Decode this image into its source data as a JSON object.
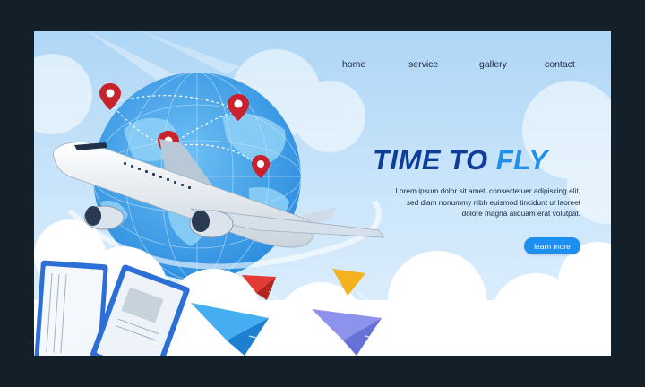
{
  "nav": {
    "items": [
      {
        "label": "home"
      },
      {
        "label": "service"
      },
      {
        "label": "gallery"
      },
      {
        "label": "contact"
      }
    ]
  },
  "hero": {
    "title_part1": "TIME TO ",
    "title_part2": "FLY",
    "description_lines": [
      "Lorem ipsum dolor sit amet, consectetuer adipiscing elit,",
      "sed diam nonummy nibh euismod tincidunt ut laoreet",
      "dolore magna aliquam erat volutpat."
    ],
    "cta_label": "learn more"
  },
  "colors": {
    "outer_background": "#13202a",
    "sky_top": "#aed6f6",
    "title_dark": "#0f3e9a",
    "title_accent": "#1f90ec",
    "button": "#1c8ff0",
    "pin": "#c8232c"
  },
  "icons": [
    "globe-icon",
    "location-pin-icon",
    "airplane-icon",
    "paper-plane-icon",
    "boarding-pass-icon"
  ]
}
